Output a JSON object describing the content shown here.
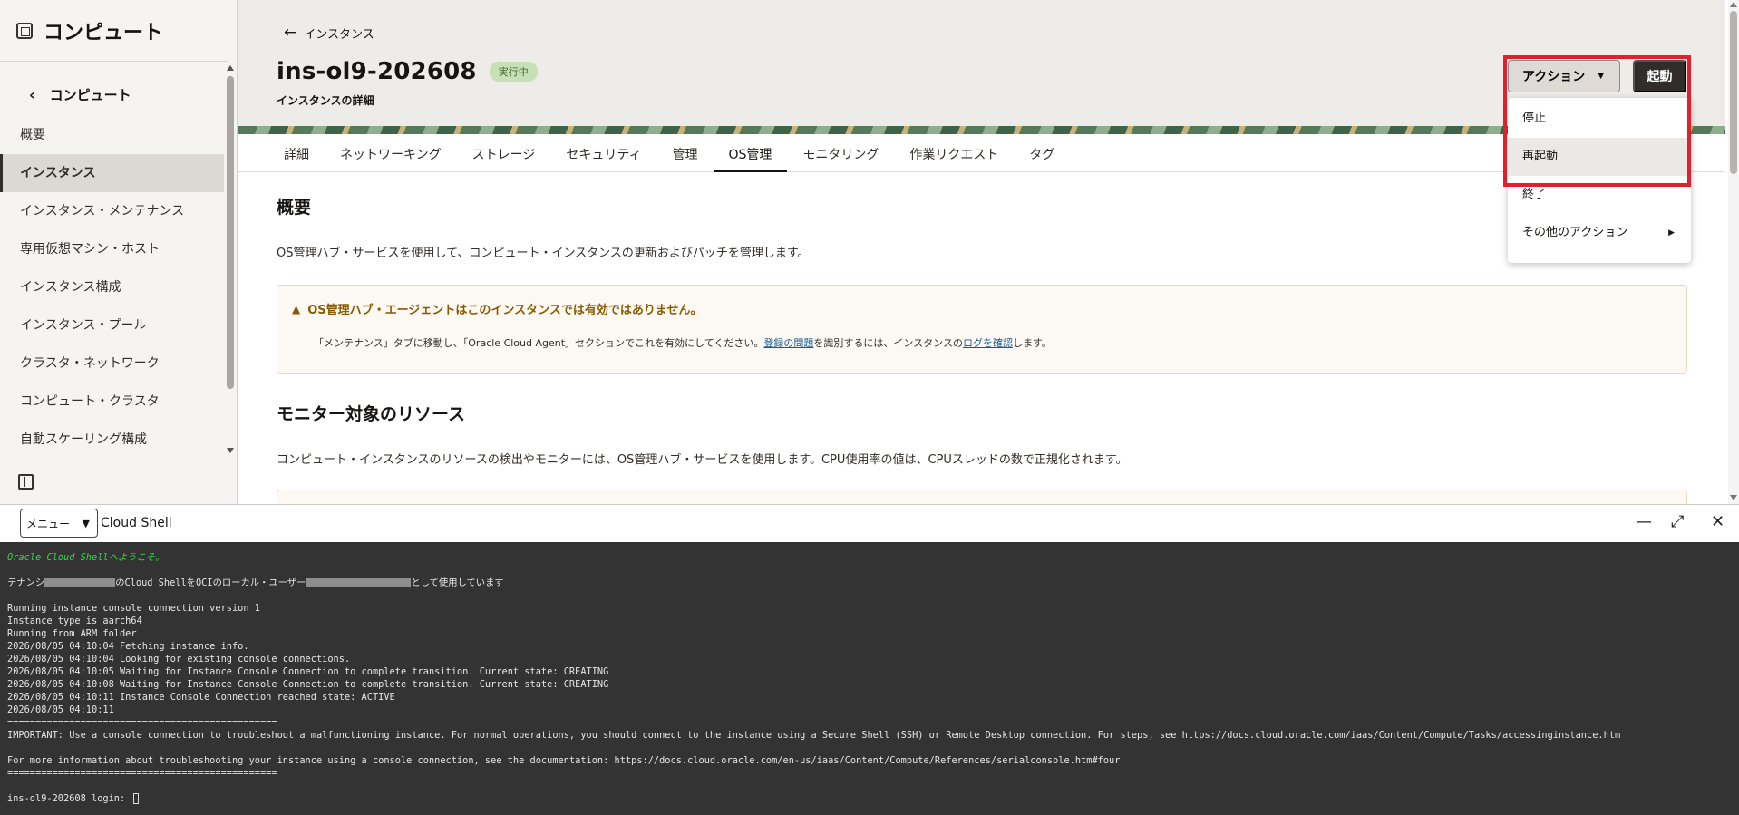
{
  "sidebar": {
    "title": "コンピュート",
    "back_label": "コンピュート",
    "items": [
      {
        "label": "概要",
        "active": false
      },
      {
        "label": "インスタンス",
        "active": true
      },
      {
        "label": "インスタンス・メンテナンス",
        "active": false
      },
      {
        "label": "専用仮想マシン・ホスト",
        "active": false
      },
      {
        "label": "インスタンス構成",
        "active": false
      },
      {
        "label": "インスタンス・プール",
        "active": false
      },
      {
        "label": "クラスタ・ネットワーク",
        "active": false
      },
      {
        "label": "コンピュート・クラスタ",
        "active": false
      },
      {
        "label": "自動スケーリング構成",
        "active": false
      }
    ]
  },
  "header": {
    "back_label": "インスタンス",
    "title": "ins-ol9-202608",
    "status": "実行中",
    "subtitle": "インスタンスの詳細"
  },
  "actions": {
    "action_label": "アクション",
    "start_label": "起動",
    "menu": [
      "停止",
      "再起動",
      "終了",
      "その他のアクション"
    ]
  },
  "tabs": [
    {
      "label": "詳細",
      "active": false
    },
    {
      "label": "ネットワーキング",
      "active": false
    },
    {
      "label": "ストレージ",
      "active": false
    },
    {
      "label": "セキュリティ",
      "active": false
    },
    {
      "label": "管理",
      "active": false
    },
    {
      "label": "OS管理",
      "active": true
    },
    {
      "label": "モニタリング",
      "active": false
    },
    {
      "label": "作業リクエスト",
      "active": false
    },
    {
      "label": "タグ",
      "active": false
    }
  ],
  "content": {
    "overview_title": "概要",
    "overview_text": "OS管理ハブ・サービスを使用して、コンピュート・インスタンスの更新およびパッチを管理します。",
    "warning_title": "OS管理ハブ・エージェントはこのインスタンスでは有効ではありません。",
    "warning_text_1": "「メンテナンス」タブに移動し、「Oracle Cloud Agent」セクションでこれを有効にしてください。",
    "warning_link_1": "登録の問題",
    "warning_text_2": "を識別するには、インスタンスの",
    "warning_link_2": "ログを確認",
    "warning_text_3": "します。",
    "monitor_title": "モニター対象のリソース",
    "monitor_text": "コンピュート・インスタンスのリソースの検出やモニターには、OS管理ハブ・サービスを使用します。CPU使用率の値は、CPUスレッドの数で正規化されます。"
  },
  "shell": {
    "menu_label": "メニュー",
    "title": "Cloud Shell",
    "welcome": "Oracle Cloud Shellへようこそ。",
    "tenancy_prefix": "テナンシ",
    "tenancy_mid": "のCloud ShellをOCIのローカル・ユーザー",
    "tenancy_suffix": "として使用しています",
    "lines": [
      "Running instance console connection version 1",
      "Instance type is aarch64",
      "Running from ARM folder",
      "2026/08/05 04:10:04 Fetching instance info.",
      "2026/08/05 04:10:04 Looking for existing console connections.",
      "2026/08/05 04:10:05 Waiting for Instance Console Connection to complete transition. Current state: CREATING",
      "2026/08/05 04:10:08 Waiting for Instance Console Connection to complete transition. Current state: CREATING",
      "2026/08/05 04:10:11 Instance Console Connection reached state: ACTIVE",
      "2026/08/05 04:10:11",
      "================================================",
      "IMPORTANT: Use a console connection to troubleshoot a malfunctioning instance. For normal operations, you should connect to the instance using a Secure Shell (SSH) or Remote Desktop connection. For steps, see https://docs.cloud.oracle.com/iaas/Content/Compute/Tasks/accessinginstance.htm",
      "",
      "For more information about troubleshooting your instance using a console connection, see the documentation: https://docs.cloud.oracle.com/en-us/iaas/Content/Compute/References/serialconsole.htm#four",
      "================================================",
      ""
    ],
    "prompt": "ins-ol9-202608 login: "
  },
  "colors": {
    "highlight": "#e0202a",
    "status_bg": "#c7e0b8",
    "terminal_bg": "#333333",
    "welcome_green": "#31d843"
  }
}
